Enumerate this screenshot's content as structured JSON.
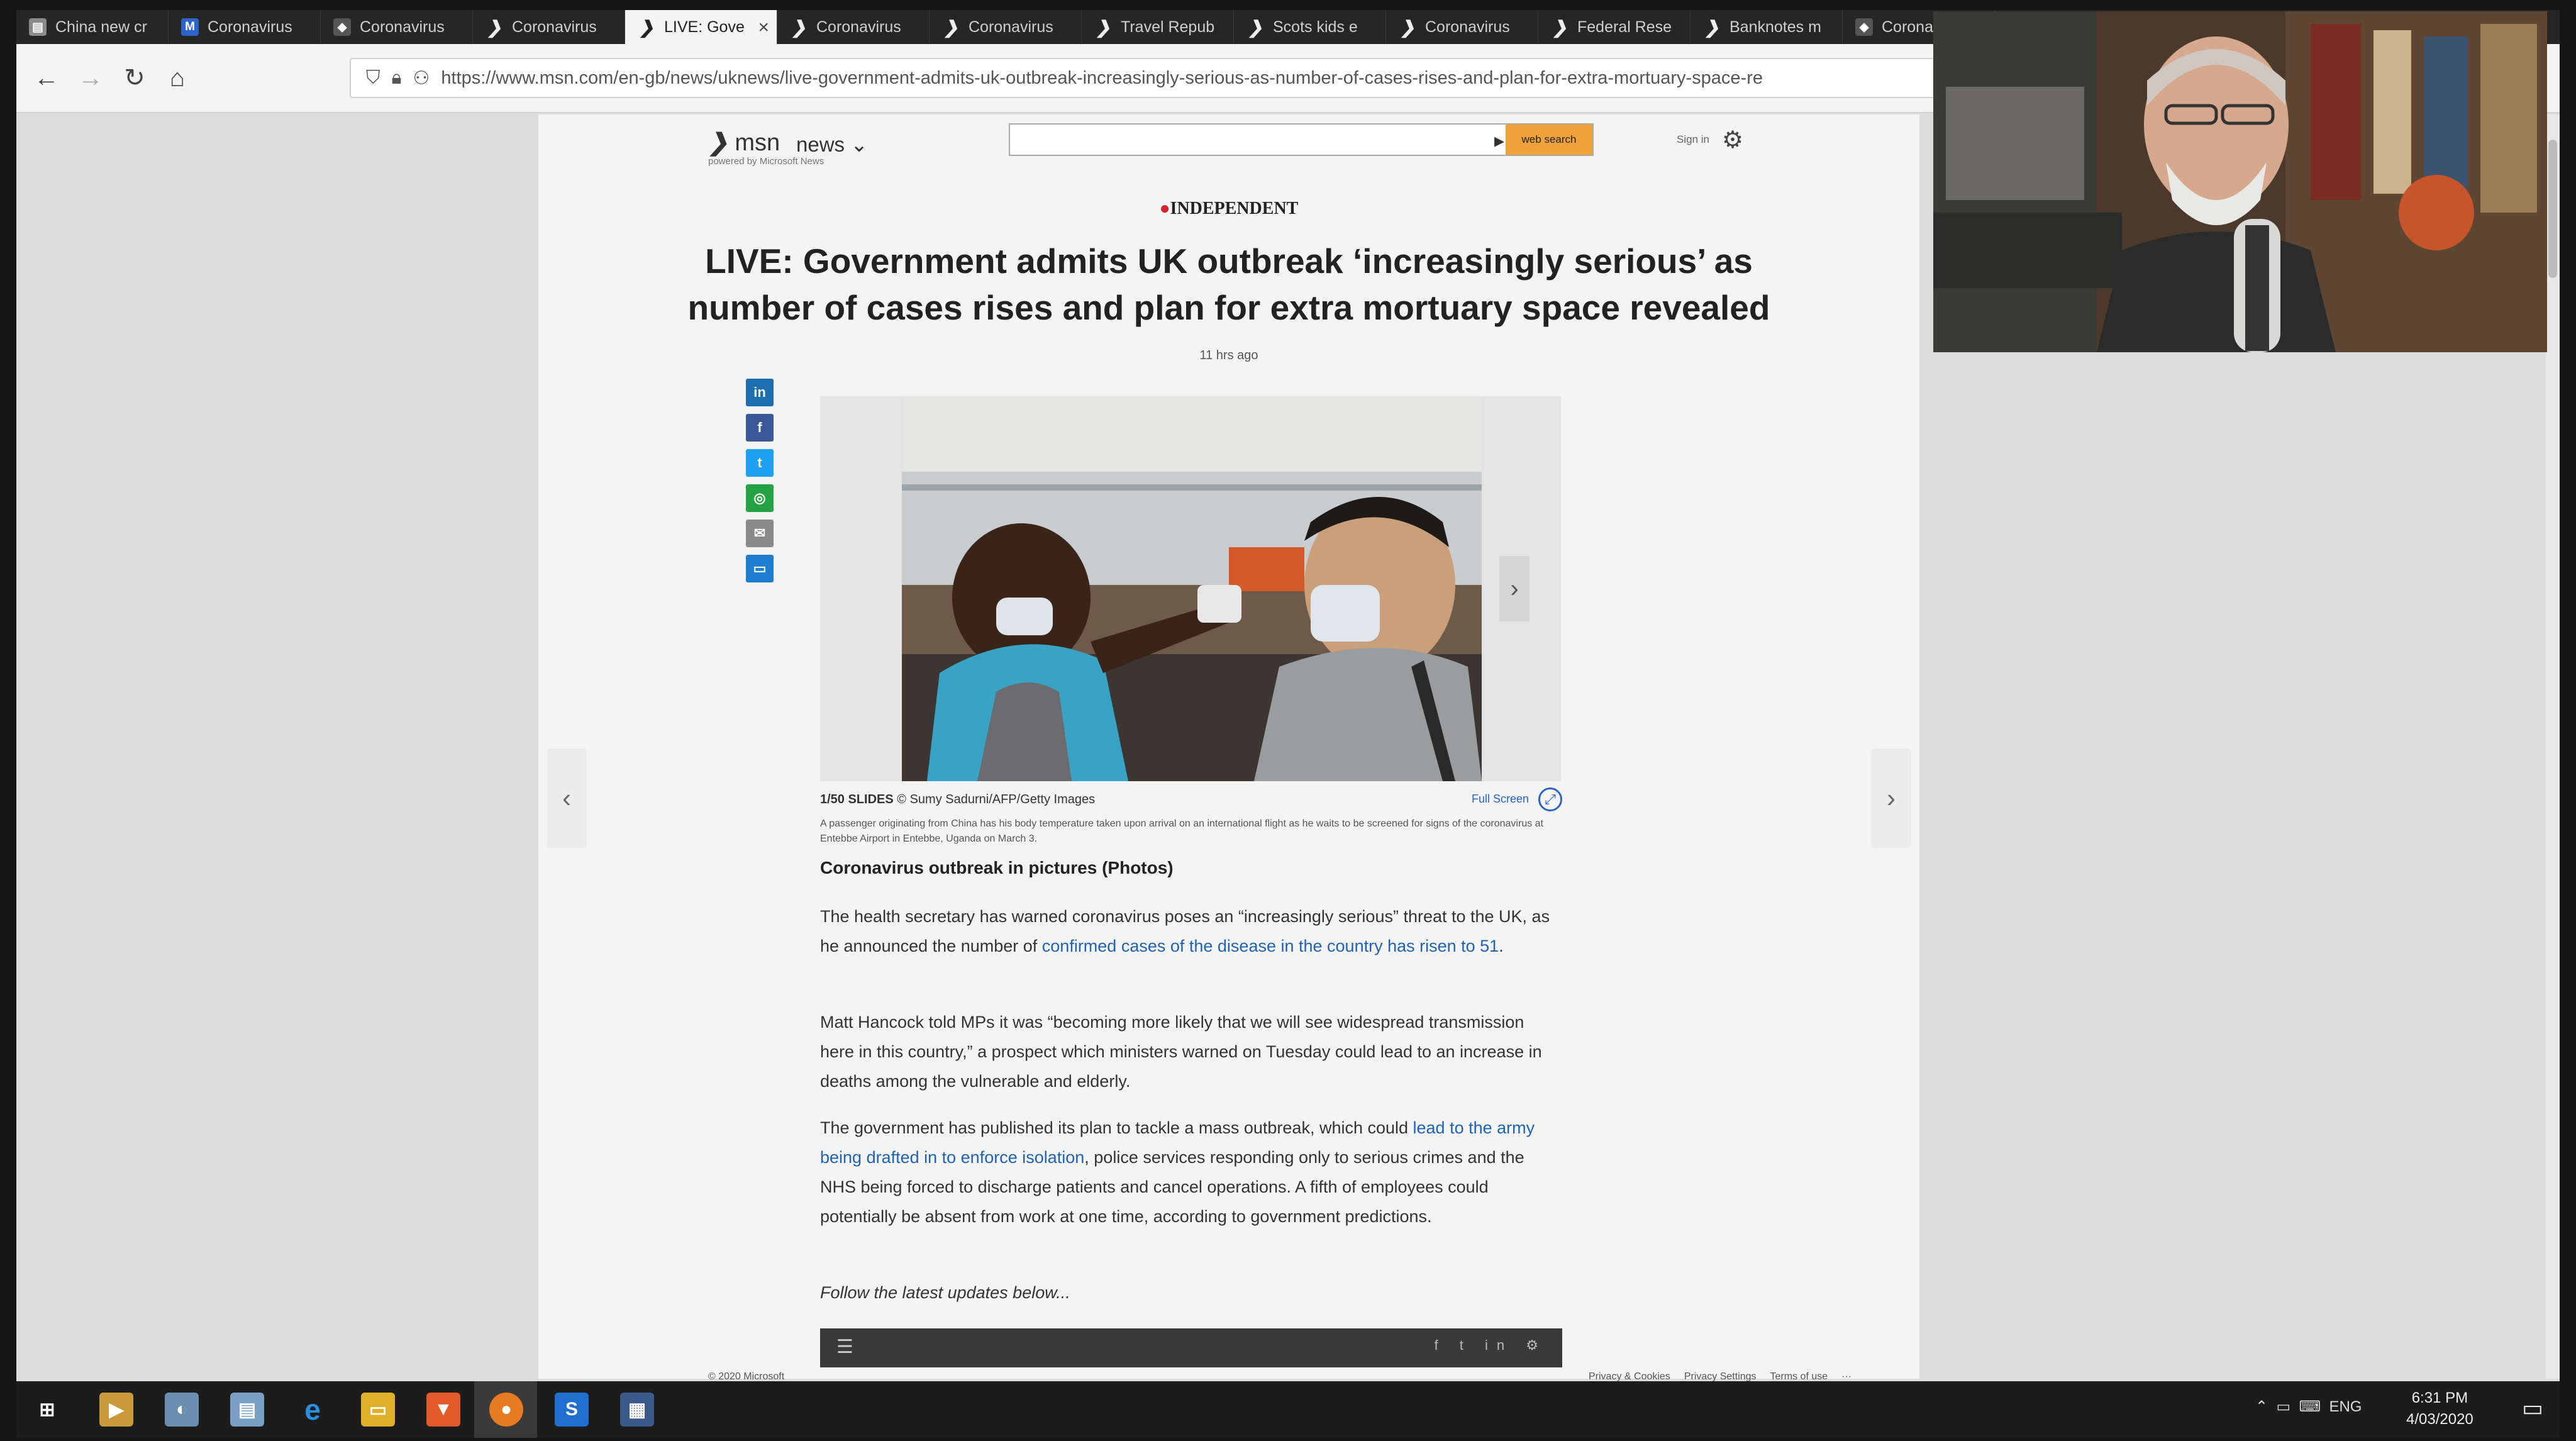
{
  "browser": {
    "tabs": [
      {
        "label": "China new cr",
        "icon": "document-icon"
      },
      {
        "label": "Coronavirus",
        "icon": "m-icon"
      },
      {
        "label": "Coronavirus",
        "icon": "dark-icon"
      },
      {
        "label": "Coronavirus",
        "icon": "msn-icon"
      },
      {
        "label": "LIVE: Gove",
        "icon": "msn-icon",
        "active": true
      },
      {
        "label": "Coronavirus",
        "icon": "msn-icon"
      },
      {
        "label": "Coronavirus",
        "icon": "msn-icon"
      },
      {
        "label": "Travel Repub",
        "icon": "msn-icon"
      },
      {
        "label": "Scots kids e",
        "icon": "msn-icon"
      },
      {
        "label": "Coronavirus",
        "icon": "msn-icon"
      },
      {
        "label": "Federal Rese",
        "icon": "msn-icon"
      },
      {
        "label": "Banknotes m",
        "icon": "msn-icon"
      },
      {
        "label": "Coronav",
        "icon": "dark-icon"
      }
    ],
    "url": "https://www.msn.com/en-gb/news/uknews/live-government-admits-uk-outbreak-increasingly-serious-as-number-of-cases-rises-and-plan-for-extra-mortuary-space-re"
  },
  "msn_header": {
    "logo": "msn",
    "powered_by": "powered by Microsoft News",
    "section": "news",
    "search_button": "web search",
    "sign_in": "Sign in"
  },
  "article": {
    "source": "INDEPENDENT",
    "headline": "LIVE: Government admits UK outbreak ‘increasingly serious’ as number of cases rises and plan for extra mortuary space revealed",
    "timestamp": "11 hrs ago",
    "slideshow": {
      "count": "1/50 SLIDES",
      "credit": "© Sumy Sadurni/AFP/Getty Images",
      "fullscreen": "Full Screen",
      "caption": "A passenger originating from China has his body temperature taken upon arrival on an international flight as he waits to be screened for signs of the coronavirus at Entebbe Airport in Entebbe, Uganda on March 3.",
      "title": "Coronavirus outbreak in pictures (Photos)"
    },
    "paragraphs": {
      "p1_a": "The health secretary has warned coronavirus poses an “increasingly serious” threat to the UK, as he announced the number of ",
      "p1_link": "confirmed cases of the disease in the country has risen to 51",
      "p1_b": ".",
      "p2": "Matt Hancock told MPs it was “becoming more likely that we will see widespread transmission here in this country,” a prospect which ministers warned on Tuesday could lead to an increase in deaths among the vulnerable and elderly.",
      "p3_a": "The government has published its plan to tackle a mass outbreak, which could ",
      "p3_link": "lead to the army being drafted in to enforce isolation",
      "p3_b": ", police services responding only to serious crimes and the NHS being forced to discharge patients and cancel operations. A fifth of employees could potentially be absent from work at one time, according to government predictions.",
      "p4": "Follow the latest updates below..."
    }
  },
  "footer": {
    "copyright": "© 2020 Microsoft",
    "links": [
      "Privacy & Cookies",
      "Privacy Settings",
      "Terms of use",
      "···"
    ]
  },
  "taskbar": {
    "language": "ENG",
    "time": "6:31 PM",
    "date": "4/03/2020"
  },
  "colors": {
    "link": "#2063b5",
    "search_button": "#f0a23a",
    "taskbar": "#1c1c1c"
  }
}
